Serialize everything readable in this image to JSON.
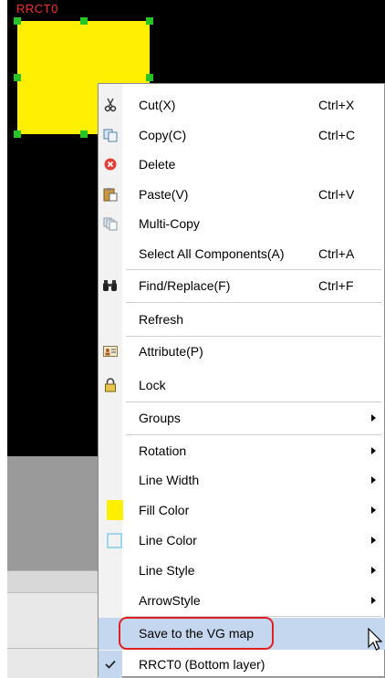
{
  "canvas": {
    "component_label": "RRCT0",
    "component_fill": "#ffef00",
    "background": "#000000"
  },
  "context_menu": {
    "items": [
      {
        "label": "Cut(X)",
        "shortcut": "Ctrl+X",
        "icon": "scissors-icon"
      },
      {
        "label": "Copy(C)",
        "shortcut": "Ctrl+C",
        "icon": "copy-icon"
      },
      {
        "label": "Delete",
        "shortcut": "",
        "icon": "delete-icon"
      },
      {
        "label": "Paste(V)",
        "shortcut": "Ctrl+V",
        "icon": "paste-icon"
      },
      {
        "label": "Multi-Copy",
        "shortcut": "",
        "icon": "multi-copy-icon"
      },
      {
        "label": "Select All Components(A)",
        "shortcut": "Ctrl+A",
        "icon": ""
      },
      {
        "label": "Find/Replace(F)",
        "shortcut": "Ctrl+F",
        "icon": "binoculars-icon"
      },
      {
        "label": "Refresh",
        "shortcut": "",
        "icon": ""
      },
      {
        "label": "Attribute(P)",
        "shortcut": "",
        "icon": "attribute-icon"
      },
      {
        "label": "Lock",
        "shortcut": "",
        "icon": "lock-icon"
      },
      {
        "label": "Groups",
        "shortcut": "",
        "submenu": true
      },
      {
        "label": "Rotation",
        "shortcut": "",
        "submenu": true
      },
      {
        "label": "Line Width",
        "shortcut": "",
        "submenu": true
      },
      {
        "label": "Fill Color",
        "shortcut": "",
        "submenu": true,
        "icon": "fill-color-swatch-icon",
        "color": "#ffef00"
      },
      {
        "label": "Line Color",
        "shortcut": "",
        "submenu": true,
        "icon": "line-color-swatch-icon",
        "color": "#9fd6ea"
      },
      {
        "label": "Line Style",
        "shortcut": "",
        "submenu": true
      },
      {
        "label": "ArrowStyle",
        "shortcut": "",
        "submenu": true
      },
      {
        "label": "Save to the VG map",
        "shortcut": "",
        "highlighted": true
      },
      {
        "label": "RRCT0 (Bottom layer)",
        "shortcut": "",
        "checked": true,
        "icon": "check-icon"
      }
    ]
  },
  "colors": {
    "highlight": "#c5d7ee",
    "annotation_box": "#e02020",
    "handle": "#26c426"
  }
}
